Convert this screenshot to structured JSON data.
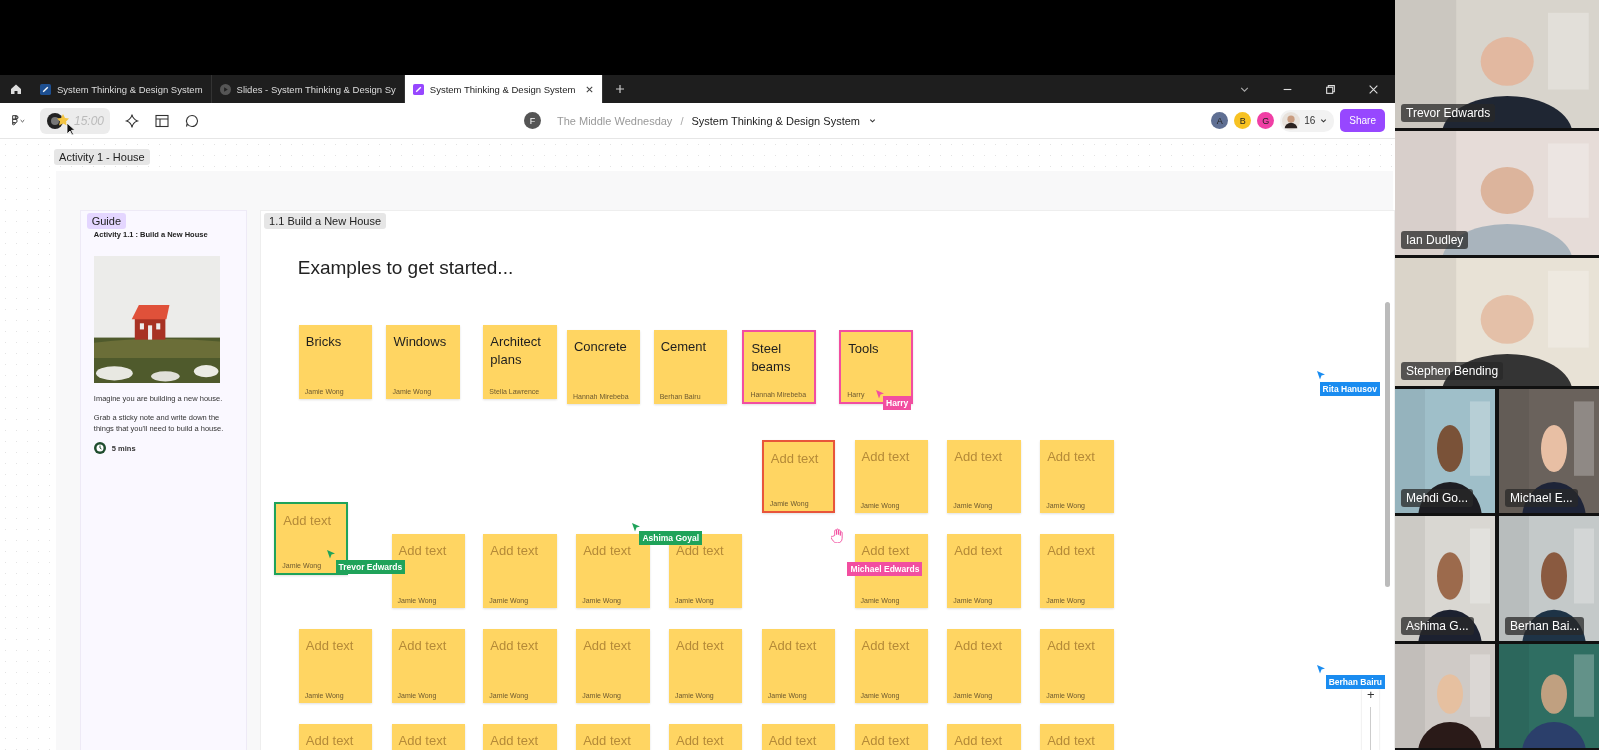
{
  "tabs": [
    {
      "label": "System Thinking & Design System",
      "selected": false,
      "kind": "figjam"
    },
    {
      "label": "Slides - System Thinking & Design Sy",
      "selected": false,
      "kind": "slides"
    },
    {
      "label": "System Thinking & Design System",
      "selected": true,
      "kind": "figjam"
    }
  ],
  "toolbar": {
    "timer": "15:00",
    "team_initial": "F",
    "team": "The Middle Wednesday",
    "separator": "/",
    "file": "System Thinking & Design System",
    "collaborators": [
      {
        "initial": "A",
        "color": "#5f6f93"
      },
      {
        "initial": "B",
        "color": "#f7c223"
      },
      {
        "initial": "G",
        "color": "#f03fa5"
      }
    ],
    "viewer_count": "16",
    "share_button": "Share"
  },
  "canvas": {
    "section_label": "Activity 1 - House",
    "guide": {
      "tag": "Guide",
      "title": "Activity 1.1 : Build a New House",
      "paragraphs": [
        "Imagine you are building a new house.",
        "Grab a sticky note and write down the things that you'll need to build a house."
      ],
      "duration": "5 mins"
    },
    "frame_label": "1.1 Build a New House",
    "heading": "Examples to get started...",
    "stickies": [
      {
        "kind": "note",
        "text": "Bricks",
        "author": "Jamie Wong",
        "selected": false
      },
      {
        "kind": "note",
        "text": "Windows",
        "author": "Jamie Wong",
        "selected": false
      },
      {
        "kind": "note",
        "text": "Architect plans",
        "author": "Stella Lawrence",
        "selected": false
      },
      {
        "kind": "note",
        "text": "Concrete",
        "author": "Hannah Mirebeba",
        "selected": false
      },
      {
        "kind": "note",
        "text": "Cement",
        "author": "Berhan Bairu",
        "selected": false
      },
      {
        "kind": "note",
        "text": "Steel beams",
        "author": "Hannah Mirebeba",
        "selected": true,
        "color": "#f24ea0"
      },
      {
        "kind": "note",
        "text": "Tools",
        "author": "Harry",
        "selected": true,
        "color": "#f24ea0"
      },
      {
        "kind": "placeholder",
        "text": "Add text",
        "author": "Jamie Wong",
        "selected": true,
        "color": "#e8553a"
      },
      {
        "kind": "placeholder",
        "text": "Add text",
        "author": "Jamie Wong",
        "selected": false
      },
      {
        "kind": "placeholder",
        "text": "Add text",
        "author": "Jamie Wong",
        "selected": false
      },
      {
        "kind": "placeholder",
        "text": "Add text",
        "author": "Jamie Wong",
        "selected": false
      },
      {
        "kind": "placeholder",
        "text": "Add text",
        "author": "Jamie Wong",
        "selected": true,
        "color": "#1fa35a"
      },
      {
        "kind": "placeholder",
        "text": "Add text",
        "author": "Jamie Wong",
        "selected": false
      },
      {
        "kind": "placeholder",
        "text": "Add text",
        "author": "Jamie Wong",
        "selected": false
      },
      {
        "kind": "placeholder",
        "text": "Add text",
        "author": "Jamie Wong",
        "selected": false
      },
      {
        "kind": "placeholder",
        "text": "Add text",
        "author": "Jamie Wong",
        "selected": false
      },
      {
        "kind": "placeholder",
        "text": "Add text",
        "author": "Jamie Wong",
        "selected": false
      },
      {
        "kind": "placeholder",
        "text": "Add text",
        "author": "Jamie Wong",
        "selected": false
      },
      {
        "kind": "placeholder",
        "text": "Add text",
        "author": "Jamie Wong",
        "selected": false
      },
      {
        "kind": "placeholder",
        "text": "Add text",
        "author": "Jamie Wong",
        "selected": false
      },
      {
        "kind": "placeholder",
        "text": "Add text",
        "author": "Jamie Wong",
        "selected": false
      },
      {
        "kind": "placeholder",
        "text": "Add text",
        "author": "Jamie Wong",
        "selected": false
      },
      {
        "kind": "placeholder",
        "text": "Add text",
        "author": "Jamie Wong",
        "selected": false
      },
      {
        "kind": "placeholder",
        "text": "Add text",
        "author": "Jamie Wong",
        "selected": false
      },
      {
        "kind": "placeholder",
        "text": "Add text",
        "author": "Jamie Wong",
        "selected": false
      },
      {
        "kind": "placeholder",
        "text": "Add text",
        "author": "Jamie Wong",
        "selected": false
      },
      {
        "kind": "placeholder",
        "text": "Add text",
        "author": "Jamie Wong",
        "selected": false
      },
      {
        "kind": "placeholder",
        "text": "Add text",
        "author": "Jamie Wong",
        "selected": false
      },
      {
        "kind": "placeholder",
        "text": "Add text",
        "selected": false
      },
      {
        "kind": "placeholder",
        "text": "Add text",
        "selected": false
      },
      {
        "kind": "placeholder",
        "text": "Add text",
        "selected": false
      },
      {
        "kind": "placeholder",
        "text": "Add text",
        "selected": false
      },
      {
        "kind": "placeholder",
        "text": "Add text",
        "selected": false
      },
      {
        "kind": "placeholder",
        "text": "Add text",
        "selected": false
      },
      {
        "kind": "placeholder",
        "text": "Add text",
        "selected": false
      },
      {
        "kind": "placeholder",
        "text": "Add text",
        "selected": false
      },
      {
        "kind": "placeholder",
        "text": "Add text",
        "selected": false
      }
    ],
    "cursors": [
      {
        "name": "Harry",
        "color": "#f24ea0",
        "kind": "arrow"
      },
      {
        "name": "Ashima Goyal",
        "color": "#1fa35a",
        "kind": "arrow"
      },
      {
        "name": "Trevor Edwards",
        "color": "#1fa35a",
        "kind": "arrow"
      },
      {
        "name": "Michael Edwards",
        "color": "#f24ea0",
        "kind": "hand"
      },
      {
        "name": "Rita Hanusov",
        "color": "#1a8cf0",
        "kind": "arrow"
      },
      {
        "name": "Berhan Bairu",
        "color": "#1a8cf0",
        "kind": "arrow"
      }
    ],
    "zoom_in": "+"
  },
  "participants": [
    {
      "kind": "video",
      "name": "Trevor Edwards"
    },
    {
      "kind": "video",
      "name": "Ian Dudley"
    },
    {
      "kind": "video",
      "name": "Stephen Bending"
    },
    {
      "kind": "video",
      "name": "Mehdi Go..."
    },
    {
      "kind": "video",
      "name": "Michael E..."
    },
    {
      "kind": "video",
      "name": "Ashima G..."
    },
    {
      "kind": "video",
      "name": "Berhan Bai..."
    },
    {
      "kind": "video"
    },
    {
      "kind": "video"
    }
  ]
}
